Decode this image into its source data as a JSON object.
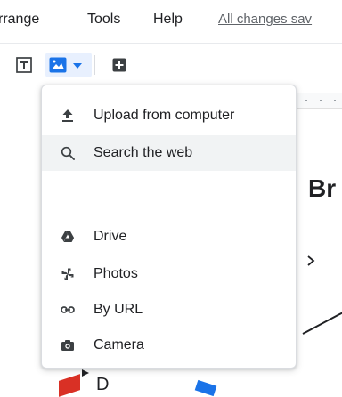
{
  "menubar": {
    "arrange": "rrange",
    "tools": "Tools",
    "help": "Help",
    "all_changes": "All changes sav"
  },
  "toolbar": {
    "items": [
      {
        "name": "text-box",
        "icon": "text-box-icon"
      },
      {
        "name": "insert-image",
        "icon": "image-icon",
        "selected": true
      },
      {
        "name": "new-slide",
        "icon": "new-slide-icon"
      }
    ]
  },
  "image_menu": {
    "options": [
      {
        "label": "Upload from computer",
        "icon": "upload-icon"
      },
      {
        "label": "Search the web",
        "icon": "search-icon",
        "highlighted": true
      },
      {
        "label": "Drive",
        "icon": "drive-icon"
      },
      {
        "label": "Photos",
        "icon": "photos-icon"
      },
      {
        "label": "By URL",
        "icon": "link-icon"
      },
      {
        "label": "Camera",
        "icon": "camera-icon"
      }
    ]
  },
  "slide": {
    "title_fragment": "Br",
    "letter": "D"
  },
  "colors": {
    "accent": "#1a73e8",
    "menu_highlight": "#f1f3f4",
    "text": "#202124",
    "red_shape": "#d93025"
  }
}
